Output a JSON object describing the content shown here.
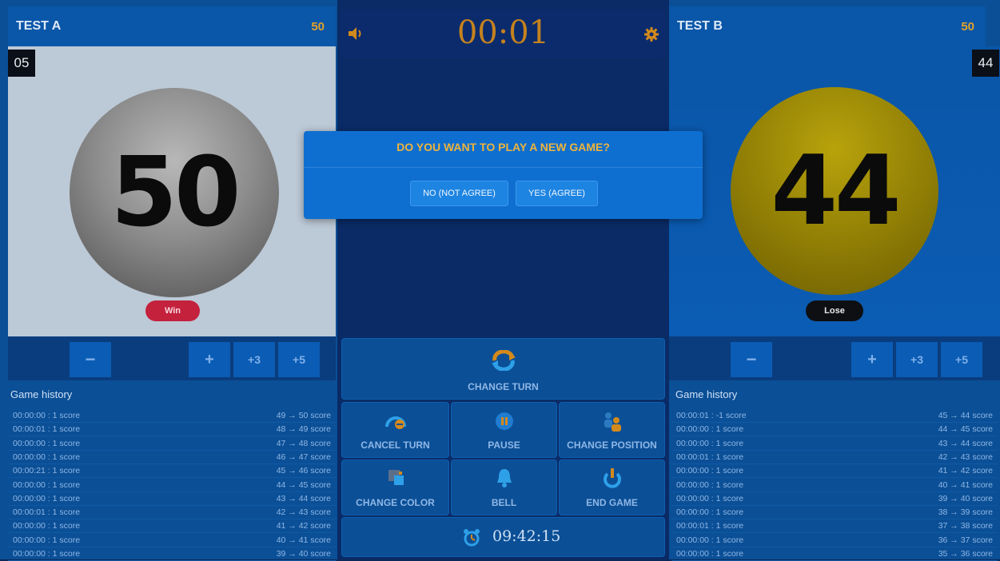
{
  "team_a": {
    "name": "TEST A",
    "score": "50",
    "counter": "05",
    "ball_number": "50",
    "result": "Win",
    "buttons": {
      "minus": "−",
      "plus": "+",
      "plus3": "+3",
      "plus5": "+5"
    },
    "history_title": "Game history",
    "history": [
      {
        "time": "00:00:00 : 1 score",
        "change": "49 → 50 score"
      },
      {
        "time": "00:00:01 : 1 score",
        "change": "48 → 49 score"
      },
      {
        "time": "00:00:00 : 1 score",
        "change": "47 → 48 score"
      },
      {
        "time": "00:00:00 : 1 score",
        "change": "46 → 47 score"
      },
      {
        "time": "00:00:21 : 1 score",
        "change": "45 → 46 score"
      },
      {
        "time": "00:00:00 : 1 score",
        "change": "44 → 45 score"
      },
      {
        "time": "00:00:00 : 1 score",
        "change": "43 → 44 score"
      },
      {
        "time": "00:00:01 : 1 score",
        "change": "42 → 43 score"
      },
      {
        "time": "00:00:00 : 1 score",
        "change": "41 → 42 score"
      },
      {
        "time": "00:00:00 : 1 score",
        "change": "40 → 41 score"
      },
      {
        "time": "00:00:00 : 1 score",
        "change": "39 → 40 score"
      }
    ]
  },
  "team_b": {
    "name": "TEST B",
    "score": "50",
    "counter": "44",
    "ball_number": "44",
    "result": "Lose",
    "buttons": {
      "minus": "−",
      "plus": "+",
      "plus3": "+3",
      "plus5": "+5"
    },
    "history_title": "Game history",
    "history": [
      {
        "time": "00:00:01 : -1 score",
        "change": "45 → 44 score"
      },
      {
        "time": "00:00:00 : 1 score",
        "change": "44 → 45 score"
      },
      {
        "time": "00:00:00 : 1 score",
        "change": "43 → 44 score"
      },
      {
        "time": "00:00:01 : 1 score",
        "change": "42 → 43 score"
      },
      {
        "time": "00:00:00 : 1 score",
        "change": "41 → 42 score"
      },
      {
        "time": "00:00:00 : 1 score",
        "change": "40 → 41 score"
      },
      {
        "time": "00:00:00 : 1 score",
        "change": "39 → 40 score"
      },
      {
        "time": "00:00:00 : 1 score",
        "change": "38 → 39 score"
      },
      {
        "time": "00:00:01 : 1 score",
        "change": "37 → 38 score"
      },
      {
        "time": "00:00:00 : 1 score",
        "change": "36 → 37 score"
      },
      {
        "time": "00:00:00 : 1 score",
        "change": "35 → 36 score"
      }
    ]
  },
  "center": {
    "timer": "00:01",
    "change_turn": "CHANGE TURN",
    "cancel_turn": "CANCEL TURN",
    "pause": "PAUSE",
    "change_position": "CHANGE POSITION",
    "change_color": "CHANGE COLOR",
    "bell": "BELL",
    "end_game": "END GAME",
    "clock": "09:42:15"
  },
  "dialog": {
    "title": "DO YOU WANT TO PLAY A NEW GAME?",
    "no_label": "NO (NOT AGREE)",
    "yes_label": "YES (AGREE)"
  },
  "colors": {
    "panel_blue": "#0b4f96",
    "accent_orange": "#e1a12a",
    "win_red": "#c4213d",
    "ball_yellow": "#8f7d05"
  }
}
